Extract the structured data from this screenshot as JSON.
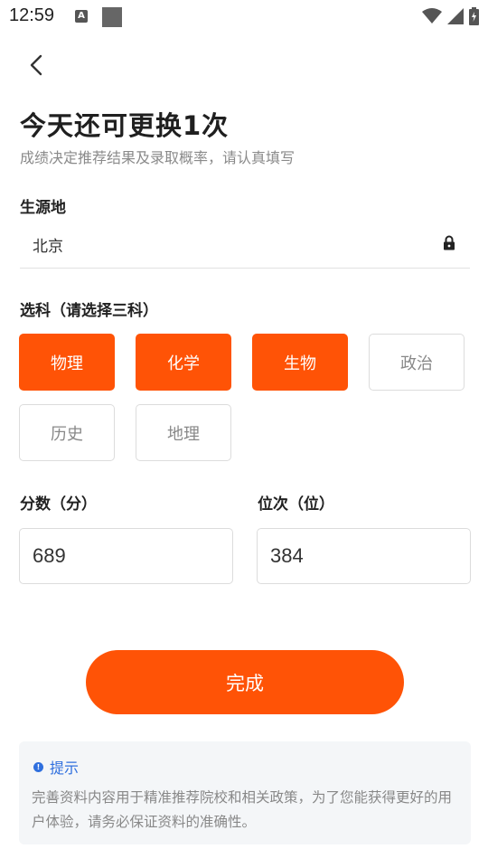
{
  "status": {
    "time": "12:59",
    "notification_label": "A"
  },
  "header": {
    "title": "今天还可更换1次",
    "subtitle": "成绩决定推荐结果及录取概率，请认真填写"
  },
  "origin": {
    "label": "生源地",
    "value": "北京"
  },
  "subjects": {
    "label": "选科（请选择三科）",
    "items": [
      {
        "label": "物理",
        "selected": true
      },
      {
        "label": "化学",
        "selected": true
      },
      {
        "label": "生物",
        "selected": true
      },
      {
        "label": "政治",
        "selected": false
      },
      {
        "label": "历史",
        "selected": false
      },
      {
        "label": "地理",
        "selected": false
      }
    ]
  },
  "score": {
    "label": "分数（分）",
    "value": "689"
  },
  "rank": {
    "label": "位次（位）",
    "value": "384"
  },
  "submit": {
    "label": "完成"
  },
  "tip": {
    "title": "提示",
    "text": "完善资料内容用于精准推荐院校和相关政策，为了您能获得更好的用户体验，请务必保证资料的准确性。"
  },
  "colors": {
    "accent": "#ff5306",
    "tip_blue": "#2f6fde"
  }
}
